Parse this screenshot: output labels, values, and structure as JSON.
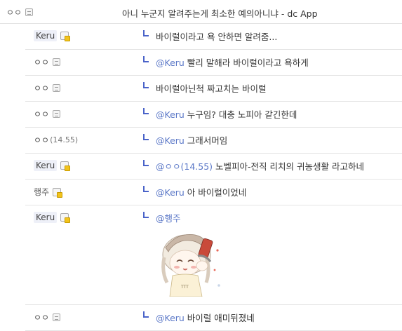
{
  "post": {
    "nick": "ㅇㅇ",
    "title": "아니 누군지 알려주는게 최소한 예의아니냐 - dc App"
  },
  "comments": [
    {
      "nick": "Keru",
      "nick_type": "fixed",
      "icon": "lock-icon",
      "mention": "",
      "text": "바이럴이라고 욕 안하면 알려줌..."
    },
    {
      "nick": "ㅇㅇ",
      "nick_type": "plain",
      "icon": "phone-icon",
      "mention": "@Keru",
      "text": " 빨리 말해라 바이럴이라고 욕하게"
    },
    {
      "nick": "ㅇㅇ",
      "nick_type": "plain",
      "icon": "phone-icon",
      "mention": "",
      "text": "바이럴아닌척 짜고치는 바이럴"
    },
    {
      "nick": "ㅇㅇ",
      "nick_type": "plain",
      "icon": "phone-icon",
      "mention": "@Keru",
      "text": " 누구임? 대충 노피아 같긴한데"
    },
    {
      "nick": "ㅇㅇ",
      "nick_type": "ip",
      "ip": "(14.55)",
      "mention": "@Keru",
      "text": " 그래서머임"
    },
    {
      "nick": "Keru",
      "nick_type": "fixed",
      "icon": "lock-icon",
      "mention": "@ㅇㅇ(14.55)",
      "text": " 노벨피아-전직 리치의 귀농생활 라고하네"
    },
    {
      "nick": "행주",
      "nick_type": "plain",
      "icon": "lock-icon",
      "mention": "@Keru",
      "text": " 아 바이럴이었네"
    },
    {
      "nick": "Keru",
      "nick_type": "fixed",
      "icon": "lock-icon",
      "mention": "@행주",
      "text": "",
      "has_dccon": true
    },
    {
      "nick": "ㅇㅇ",
      "nick_type": "plain",
      "icon": "phone-icon",
      "mention": "@Keru",
      "text": " 바이럴 애미뒤졌네"
    }
  ],
  "colors": {
    "mention": "#5a77c7",
    "reply_mark": "#4a63c9",
    "fixed_nick_bg": "#eef0f8",
    "divider": "#e4e4e4"
  }
}
